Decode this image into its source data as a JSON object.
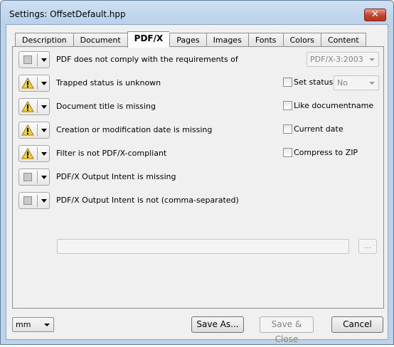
{
  "window": {
    "title": "Settings:  OffsetDefault.hpp",
    "close_glyph": "✕"
  },
  "tabs": [
    {
      "label": "Description"
    },
    {
      "label": "Document"
    },
    {
      "label": "PDF/X"
    },
    {
      "label": "Pages"
    },
    {
      "label": "Images"
    },
    {
      "label": "Fonts"
    },
    {
      "label": "Colors"
    },
    {
      "label": "Content"
    }
  ],
  "active_tab": "PDF/X",
  "rules": [
    {
      "status_icon": "gray-square-icon",
      "label": "PDF does not comply with the requirements of"
    },
    {
      "status_icon": "warning-icon",
      "label": "Trapped status is unknown"
    },
    {
      "status_icon": "warning-icon",
      "label": "Document title is missing"
    },
    {
      "status_icon": "warning-icon",
      "label": "Creation or modification date is missing"
    },
    {
      "status_icon": "warning-icon",
      "label": "Filter is not PDF/X-compliant"
    },
    {
      "status_icon": "gray-square-icon",
      "label": "PDF/X Output Intent is missing"
    },
    {
      "status_icon": "gray-square-icon",
      "label": "PDF/X Output Intent is not (comma-separated)"
    }
  ],
  "pdfx_version": {
    "value": "PDF/X-3:2003"
  },
  "options": {
    "set_status": {
      "label": "Set status",
      "checked": false
    },
    "status_value": {
      "value": "No"
    },
    "like_documentname": {
      "label": "Like documentname",
      "checked": false
    },
    "current_date": {
      "label": "Current date",
      "checked": false
    },
    "compress_to_zip": {
      "label": "Compress to ZIP",
      "checked": false
    }
  },
  "output_intent": {
    "value": "",
    "browse_label": "..."
  },
  "footer": {
    "unit": "mm",
    "save_as_label": "Save As...",
    "save_close_label": "Save & Close",
    "cancel_label": "Cancel"
  },
  "colors": {
    "window_frame": "#bcd3ea",
    "close_button": "#c5452f",
    "warning_yellow": "#f5d230"
  }
}
